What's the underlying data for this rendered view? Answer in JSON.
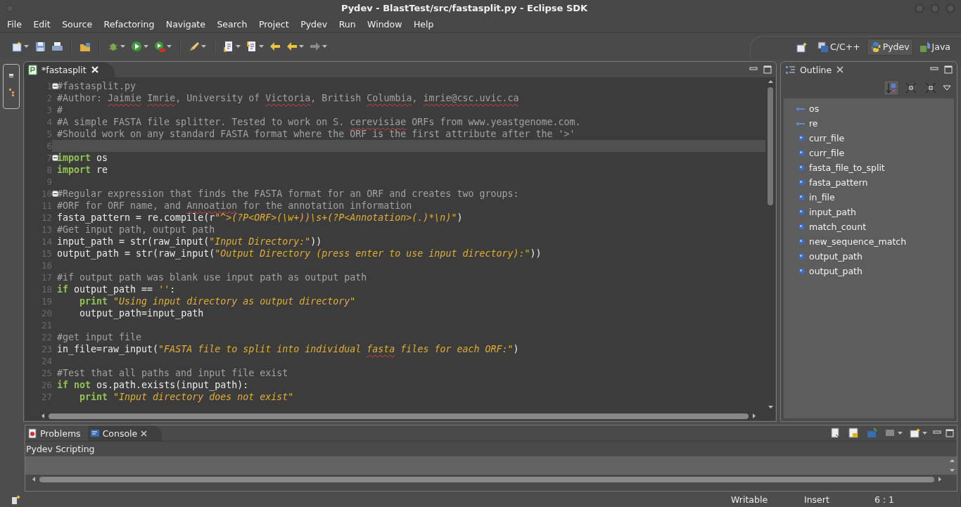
{
  "window": {
    "title": "Pydev - BlastTest/src/fastasplit.py - Eclipse SDK"
  },
  "menu": [
    "File",
    "Edit",
    "Source",
    "Refactoring",
    "Navigate",
    "Search",
    "Project",
    "Pydev",
    "Run",
    "Window",
    "Help"
  ],
  "perspectives": [
    {
      "label": "C/C++",
      "selected": false
    },
    {
      "label": "Pydev",
      "selected": true
    },
    {
      "label": "Java",
      "selected": false
    }
  ],
  "editor": {
    "tab": {
      "label": "*fastasplit"
    },
    "lines": [
      {
        "number": "1",
        "fold": true,
        "current": false,
        "tokens": [
          {
            "text": "#fastasplit.py",
            "kind": "comment"
          }
        ]
      },
      {
        "number": "2",
        "fold": false,
        "current": false,
        "tokens": [
          {
            "text": "#Author: ",
            "kind": "comment"
          },
          {
            "text": "Jaimie",
            "kind": "comment-typo"
          },
          {
            "text": " Imrie",
            "kind": "comment-typo"
          },
          {
            "text": ", University of ",
            "kind": "comment"
          },
          {
            "text": "Victoria",
            "kind": "comment-typo"
          },
          {
            "text": ", British ",
            "kind": "comment"
          },
          {
            "text": "Columbia",
            "kind": "comment-typo"
          },
          {
            "text": ", ",
            "kind": "comment"
          },
          {
            "text": "imrie@csc.uvic.ca",
            "kind": "comment-typo"
          }
        ]
      },
      {
        "number": "3",
        "fold": false,
        "current": false,
        "tokens": [
          {
            "text": "#",
            "kind": "comment"
          }
        ]
      },
      {
        "number": "4",
        "fold": false,
        "current": false,
        "tokens": [
          {
            "text": "#A simple FASTA file splitter. Tested to work on S. ",
            "kind": "comment"
          },
          {
            "text": "cerevisiae",
            "kind": "comment-typo"
          },
          {
            "text": " ORFs from www.yeastgenome.com.",
            "kind": "comment"
          }
        ]
      },
      {
        "number": "5",
        "fold": false,
        "current": false,
        "tokens": [
          {
            "text": "#Should work on any standard FASTA format where the ORF is the first attribute after the '>'",
            "kind": "comment"
          }
        ]
      },
      {
        "number": "6",
        "fold": false,
        "current": true
      },
      {
        "number": "7",
        "fold": true,
        "current": false,
        "tokens": [
          {
            "text": "import",
            "kind": "keyword"
          },
          {
            "text": " os",
            "kind": "plain"
          }
        ]
      },
      {
        "number": "8",
        "fold": false,
        "current": false,
        "tokens": [
          {
            "text": "import",
            "kind": "keyword"
          },
          {
            "text": " re",
            "kind": "plain"
          }
        ]
      },
      {
        "number": "9",
        "fold": false,
        "current": false
      },
      {
        "number": "10",
        "fold": true,
        "current": false,
        "tokens": [
          {
            "text": "#Regular expression that finds the FASTA format for an ORF and creates two groups:",
            "kind": "comment"
          }
        ]
      },
      {
        "number": "11",
        "fold": false,
        "current": false,
        "tokens": [
          {
            "text": "#ORF for ORF name, and ",
            "kind": "comment"
          },
          {
            "text": "Annoation",
            "kind": "comment-typo"
          },
          {
            "text": " for the annotation information",
            "kind": "comment"
          }
        ]
      },
      {
        "number": "12",
        "fold": false,
        "current": false,
        "tokens": [
          {
            "text": "fasta_pattern = re.compile(r",
            "kind": "plain"
          },
          {
            "text": "\"^>(?P<ORF>(\\w+))\\s+(?P<Annotation>(.)*\\n)\"",
            "kind": "string"
          },
          {
            "text": ")",
            "kind": "plain"
          }
        ]
      },
      {
        "number": "13",
        "fold": false,
        "current": false,
        "tokens": [
          {
            "text": "#Get input path, output path",
            "kind": "comment"
          }
        ]
      },
      {
        "number": "14",
        "fold": false,
        "current": false,
        "tokens": [
          {
            "text": "input_path = str(raw_input(",
            "kind": "plain"
          },
          {
            "text": "\"Input Directory:\"",
            "kind": "string"
          },
          {
            "text": "))",
            "kind": "plain"
          }
        ]
      },
      {
        "number": "15",
        "fold": false,
        "current": false,
        "tokens": [
          {
            "text": "output_path = str(raw_input(",
            "kind": "plain"
          },
          {
            "text": "\"Output Directory (press enter to use input directory):\"",
            "kind": "string"
          },
          {
            "text": "))",
            "kind": "plain"
          }
        ]
      },
      {
        "number": "16",
        "fold": false,
        "current": false
      },
      {
        "number": "17",
        "fold": false,
        "current": false,
        "tokens": [
          {
            "text": "#if output path was blank use input path as output path",
            "kind": "comment"
          }
        ]
      },
      {
        "number": "18",
        "fold": false,
        "current": false,
        "tokens": [
          {
            "text": "if",
            "kind": "keyword"
          },
          {
            "text": " output_path == ",
            "kind": "plain"
          },
          {
            "text": "''",
            "kind": "string"
          },
          {
            "text": ":",
            "kind": "plain"
          }
        ]
      },
      {
        "number": "19",
        "fold": false,
        "current": false,
        "tokens": [
          {
            "text": "    print",
            "kind": "keyword"
          },
          {
            "text": " \"Using input directory as output directory\"",
            "kind": "string"
          }
        ]
      },
      {
        "number": "20",
        "fold": false,
        "current": false,
        "tokens": [
          {
            "text": "    output_path=input_path",
            "kind": "plain"
          }
        ]
      },
      {
        "number": "21",
        "fold": false,
        "current": false
      },
      {
        "number": "22",
        "fold": false,
        "current": false,
        "tokens": [
          {
            "text": "#get input file",
            "kind": "comment"
          }
        ]
      },
      {
        "number": "23",
        "fold": false,
        "current": false,
        "tokens": [
          {
            "text": "in_file=raw_input(",
            "kind": "plain"
          },
          {
            "text": "\"FASTA file to split into individual ",
            "kind": "string"
          },
          {
            "text": "fasta",
            "kind": "string-typo"
          },
          {
            "text": " files for each ORF:\"",
            "kind": "string"
          },
          {
            "text": ")",
            "kind": "plain"
          }
        ]
      },
      {
        "number": "24",
        "fold": false,
        "current": false
      },
      {
        "number": "25",
        "fold": false,
        "current": false,
        "tokens": [
          {
            "text": "#Test that all paths and input file exist",
            "kind": "comment"
          }
        ]
      },
      {
        "number": "26",
        "fold": false,
        "current": false,
        "tokens": [
          {
            "text": "if",
            "kind": "keyword"
          },
          {
            "text": " not",
            "kind": "keyword"
          },
          {
            "text": " os.path.exists(input_path):",
            "kind": "plain"
          }
        ]
      },
      {
        "number": "27",
        "fold": false,
        "current": false,
        "tokens": [
          {
            "text": "    print",
            "kind": "keyword"
          },
          {
            "text": " \"Input directory does not exist\"",
            "kind": "string"
          }
        ]
      }
    ]
  },
  "outline": {
    "title": "Outline",
    "items": [
      {
        "label": "os",
        "kind": "import"
      },
      {
        "label": "re",
        "kind": "import"
      },
      {
        "label": "curr_file",
        "kind": "variable"
      },
      {
        "label": "curr_file",
        "kind": "variable"
      },
      {
        "label": "fasta_file_to_split",
        "kind": "variable"
      },
      {
        "label": "fasta_pattern",
        "kind": "variable"
      },
      {
        "label": "in_file",
        "kind": "variable"
      },
      {
        "label": "input_path",
        "kind": "variable"
      },
      {
        "label": "match_count",
        "kind": "variable"
      },
      {
        "label": "new_sequence_match",
        "kind": "variable"
      },
      {
        "label": "output_path",
        "kind": "variable"
      },
      {
        "label": "output_path",
        "kind": "variable"
      }
    ]
  },
  "bottom_panel": {
    "tabs": [
      {
        "label": "Problems",
        "selected": false
      },
      {
        "label": "Console",
        "selected": true
      }
    ],
    "console_title": "Pydev Scripting"
  },
  "status_bar": {
    "mode": "Writable",
    "insert_mode": "Insert",
    "position": "6 : 1"
  }
}
